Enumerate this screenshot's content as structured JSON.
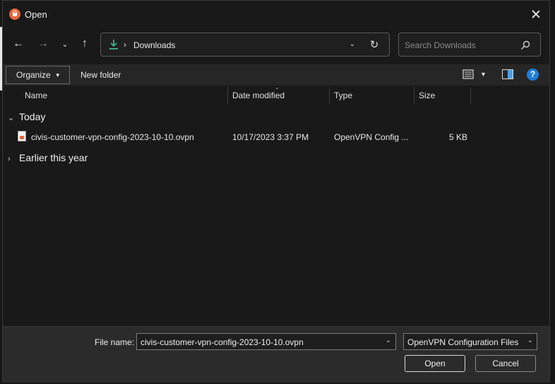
{
  "window": {
    "title": "Open",
    "close_label": "close"
  },
  "nav": {
    "address_folder": "Downloads",
    "search_placeholder": "Search Downloads"
  },
  "toolbar": {
    "organize_label": "Organize",
    "new_folder_label": "New folder",
    "help_label": "?"
  },
  "columns": {
    "name": "Name",
    "date_modified": "Date modified",
    "type": "Type",
    "size": "Size"
  },
  "groups": {
    "today": "Today",
    "earlier": "Earlier this year"
  },
  "files": [
    {
      "name": "civis-customer-vpn-config-2023-10-10.ovpn",
      "date_modified": "10/17/2023 3:37 PM",
      "type": "OpenVPN Config ...",
      "size": "5 KB"
    }
  ],
  "footer": {
    "file_name_label": "File name:",
    "file_name_value": "civis-customer-vpn-config-2023-10-10.ovpn",
    "file_type_value": "OpenVPN Configuration Files (*",
    "open_label": "Open",
    "cancel_label": "Cancel"
  },
  "colors": {
    "accent": "#1e7fd6",
    "download_arrow": "#3bb08f",
    "app_icon": "#e8673a"
  }
}
